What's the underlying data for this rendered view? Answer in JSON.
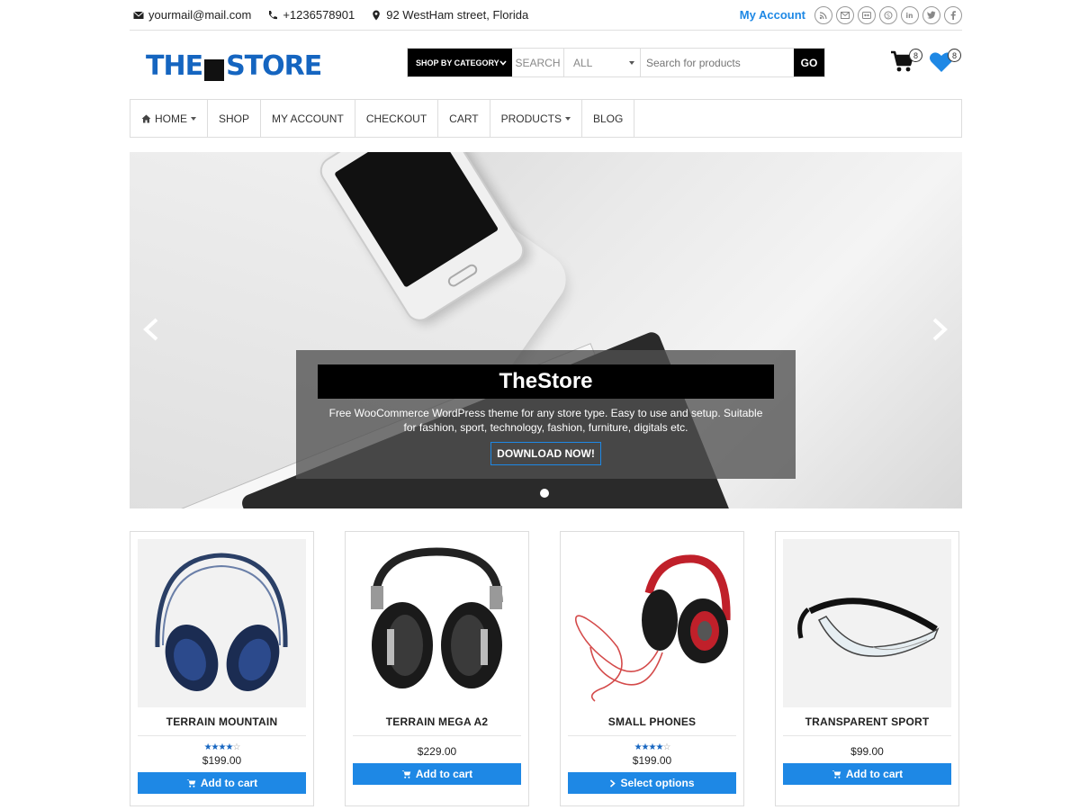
{
  "topbar": {
    "email": "yourmail@mail.com",
    "phone": "+1236578901",
    "address": "92 WestHam street, Florida",
    "my_account": "My Account",
    "social_icons": [
      "rss-icon",
      "mail-icon",
      "flickr-icon",
      "skype-icon",
      "linkedin-icon",
      "twitter-icon",
      "facebook-icon"
    ]
  },
  "header": {
    "logo_left": "THE",
    "logo_right": "STORE",
    "shop_by_category": "SHOP BY CATEGORY",
    "search_label": "SEARCH",
    "category_selected": "ALL",
    "search_placeholder": "Search for products",
    "go_label": "GO",
    "cart_count": "8",
    "wishlist_count": "8"
  },
  "nav": {
    "items": [
      {
        "label": "HOME",
        "dropdown": true
      },
      {
        "label": "SHOP",
        "dropdown": false
      },
      {
        "label": "MY ACCOUNT",
        "dropdown": false
      },
      {
        "label": "CHECKOUT",
        "dropdown": false
      },
      {
        "label": "CART",
        "dropdown": false
      },
      {
        "label": "PRODUCTS",
        "dropdown": true
      },
      {
        "label": "BLOG",
        "dropdown": false
      }
    ]
  },
  "hero": {
    "title": "TheStore",
    "description": "Free WooCommerce WordPress theme for any store type. Easy to use and setup. Suitable for fashion, sport, technology, fashion, furniture, digitals etc.",
    "button": "DOWNLOAD NOW!"
  },
  "products": [
    {
      "name": "TERRAIN MOUNTAIN",
      "price": "$199.00",
      "rating": 4,
      "button": "Add to cart"
    },
    {
      "name": "TERRAIN MEGA A2",
      "price": "$229.00",
      "rating": 0,
      "button": "Add to cart"
    },
    {
      "name": "SMALL PHONES",
      "price": "$199.00",
      "rating": 4,
      "button": "Select options"
    },
    {
      "name": "TRANSPARENT SPORT",
      "price": "$99.00",
      "rating": 0,
      "button": "Add to cart"
    }
  ],
  "colors": {
    "accent": "#1e88e5",
    "logo": "#1565c0",
    "dark": "#000000"
  }
}
